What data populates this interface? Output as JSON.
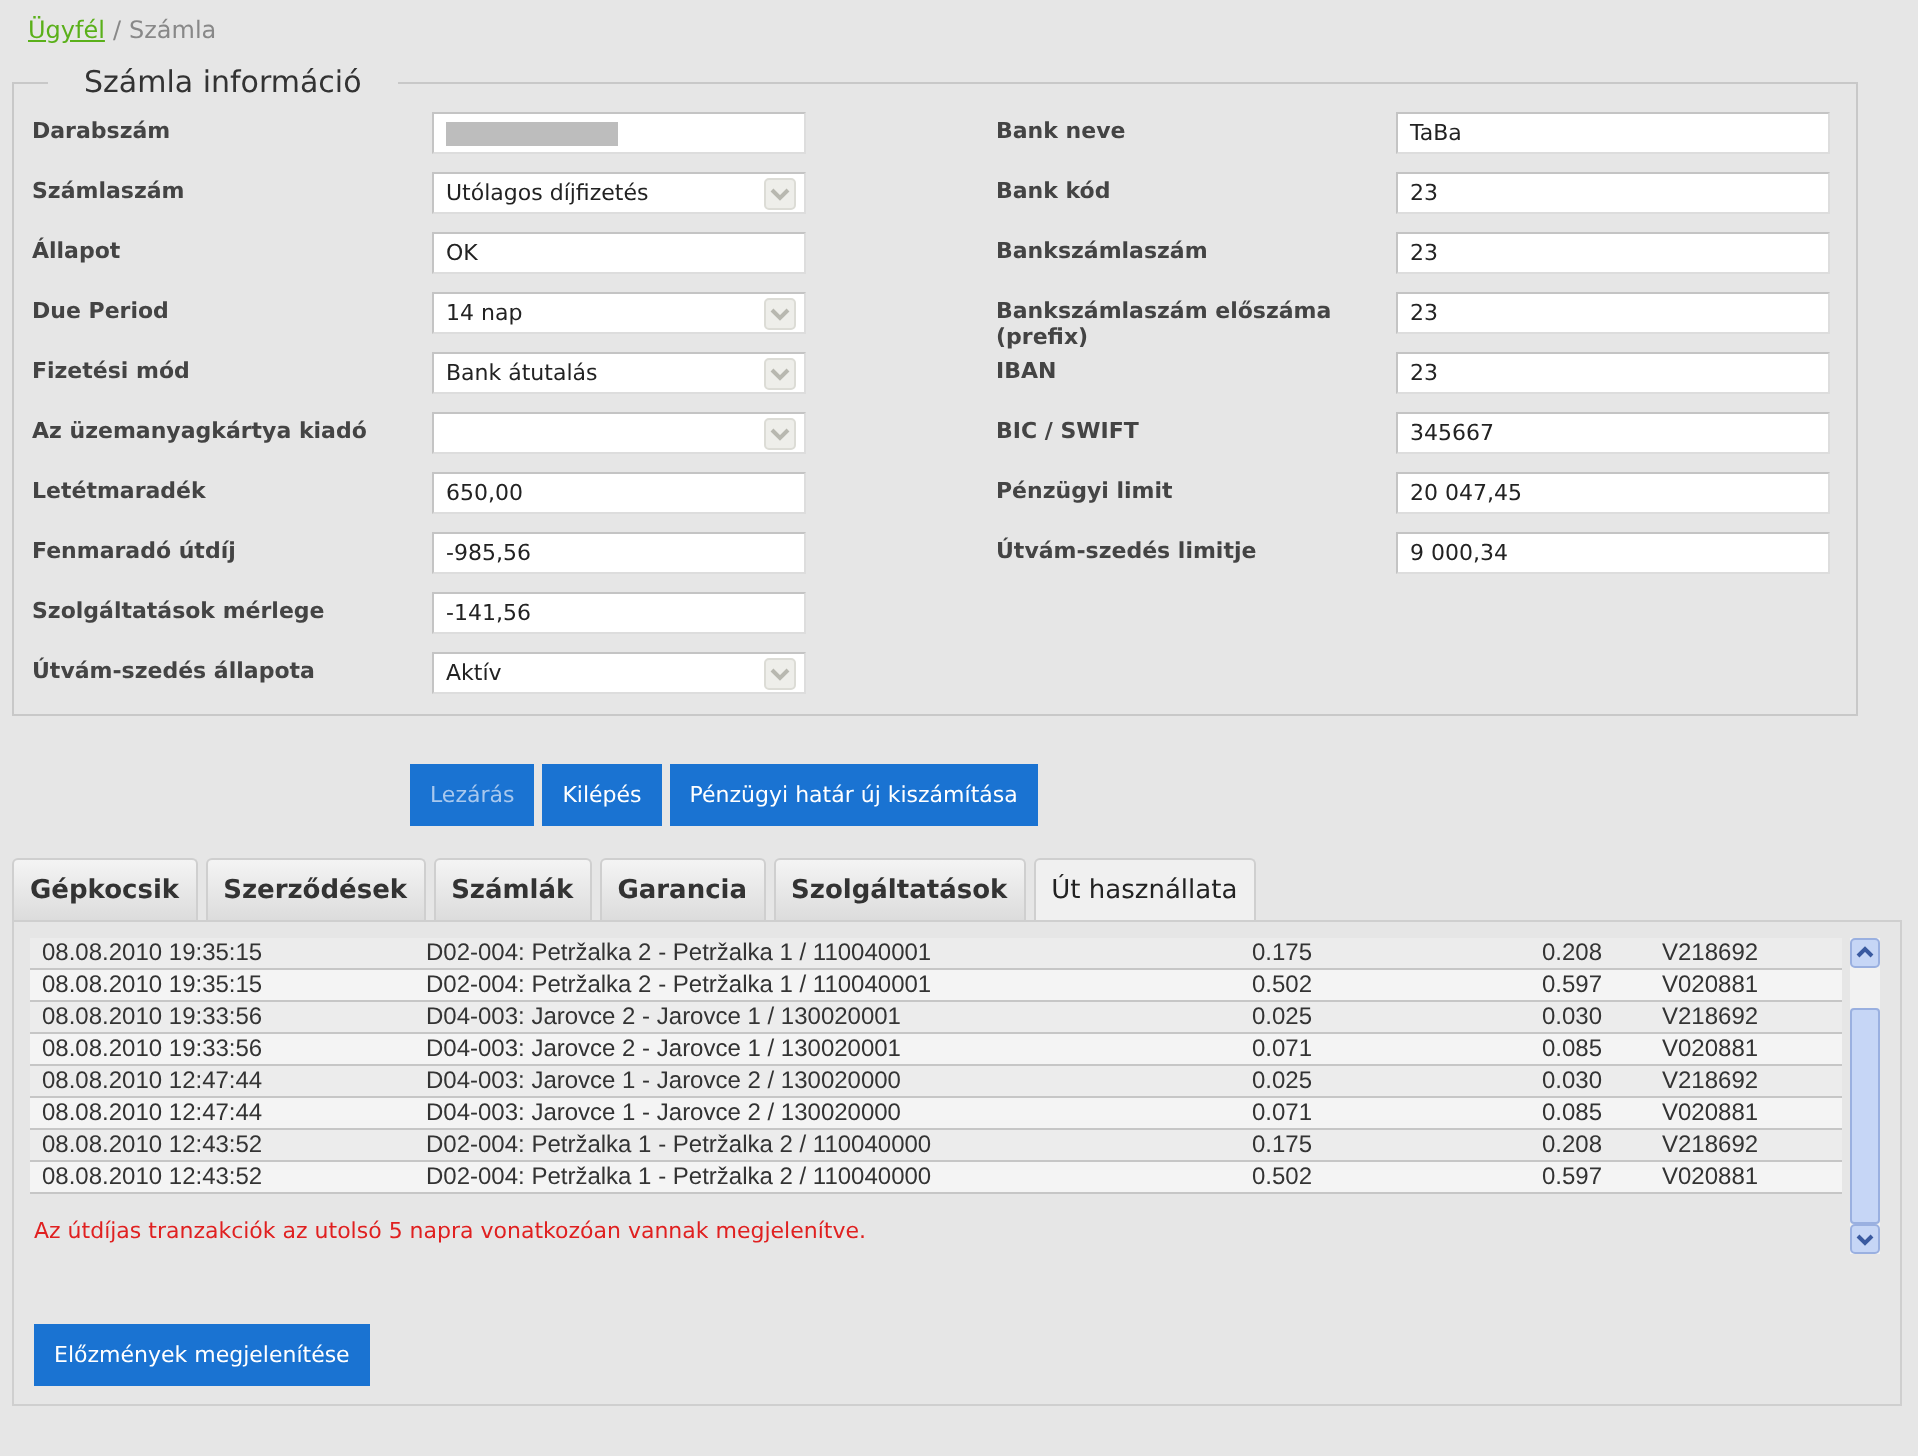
{
  "breadcrumb": {
    "separator": "/",
    "items": [
      {
        "label": "Ügyfél",
        "link": true
      },
      {
        "label": "Számla",
        "link": false
      }
    ]
  },
  "account_info": {
    "title": "Számla információ",
    "left_fields": [
      {
        "label": "Darabszám",
        "kind": "text",
        "redacted": true
      },
      {
        "label": "Számlaszám",
        "kind": "select",
        "value": "Utólagos díjfizetés"
      },
      {
        "label": "Állapot",
        "kind": "text",
        "value": "OK"
      },
      {
        "label": "Due Period",
        "kind": "select",
        "value": "14 nap"
      },
      {
        "label": "Fizetési mód",
        "kind": "select",
        "value": "Bank átutalás"
      },
      {
        "label": "Az üzemanyagkártya kiadó",
        "kind": "select"
      },
      {
        "label": "Letétmaradék",
        "kind": "text",
        "value": "650,00"
      },
      {
        "label": "Fenmaradó útdíj",
        "kind": "text",
        "value": "-985,56"
      },
      {
        "label": "Szolgáltatások mérlege",
        "kind": "text",
        "value": "-141,56"
      },
      {
        "label": "Útvám-szedés állapota",
        "kind": "select",
        "value": "Aktív"
      }
    ],
    "right_fields": [
      {
        "label": "Bank neve",
        "kind": "text",
        "value": "TaBa"
      },
      {
        "label": "Bank kód",
        "kind": "text",
        "value": "23"
      },
      {
        "label": "Bankszámlaszám",
        "kind": "text",
        "value": "23"
      },
      {
        "label": "Bankszámlaszám előszáma (prefix)",
        "kind": "text",
        "value": "23"
      },
      {
        "label": "IBAN",
        "kind": "text",
        "value": "23"
      },
      {
        "label": "BIC / SWIFT",
        "kind": "text",
        "value": "345667"
      },
      {
        "label": "Pénzügyi limit",
        "kind": "text",
        "value": "20 047,45"
      },
      {
        "label": "Útvám-szedés limitje",
        "kind": "text",
        "value": "9 000,34"
      }
    ]
  },
  "buttons": [
    {
      "label": "Lezárás",
      "disabled": true
    },
    {
      "label": "Kilépés",
      "disabled": false
    },
    {
      "label": "Pénzügyi határ új kiszámítása",
      "disabled": false
    }
  ],
  "tabs": [
    {
      "label": "Gépkocsik",
      "selected": false
    },
    {
      "label": "Szerződések",
      "selected": false
    },
    {
      "label": "Számlák",
      "selected": false
    },
    {
      "label": "Garancia",
      "selected": false
    },
    {
      "label": "Szolgáltatások",
      "selected": false
    },
    {
      "label": "Út használlata",
      "selected": true
    }
  ],
  "table": {
    "rows": [
      [
        "08.08.2010 19:35:15",
        "D02-004: Petržalka 2 - Petržalka 1 / 110040001",
        "0.175",
        "0.208",
        "V218692"
      ],
      [
        "08.08.2010 19:35:15",
        "D02-004: Petržalka 2 - Petržalka 1 / 110040001",
        "0.502",
        "0.597",
        "V020881"
      ],
      [
        "08.08.2010 19:33:56",
        "D04-003: Jarovce 2 - Jarovce 1 / 130020001",
        "0.025",
        "0.030",
        "V218692"
      ],
      [
        "08.08.2010 19:33:56",
        "D04-003: Jarovce 2 - Jarovce 1 / 130020001",
        "0.071",
        "0.085",
        "V020881"
      ],
      [
        "08.08.2010 12:47:44",
        "D04-003: Jarovce 1 - Jarovce 2 / 130020000",
        "0.025",
        "0.030",
        "V218692"
      ],
      [
        "08.08.2010 12:47:44",
        "D04-003: Jarovce 1 - Jarovce 2 / 130020000",
        "0.071",
        "0.085",
        "V020881"
      ],
      [
        "08.08.2010 12:43:52",
        "D02-004: Petržalka 1 - Petržalka 2 / 110040000",
        "0.175",
        "0.208",
        "V218692"
      ],
      [
        "08.08.2010 12:43:52",
        "D02-004: Petržalka 1 - Petržalka 2 / 110040000",
        "0.502",
        "0.597",
        "V020881"
      ]
    ]
  },
  "notice": "Az útdíjas tranzakciók az utolsó 5 napra vonatkozóan vannak megjelenítve.",
  "history_button": "Előzmények megjelenítése"
}
